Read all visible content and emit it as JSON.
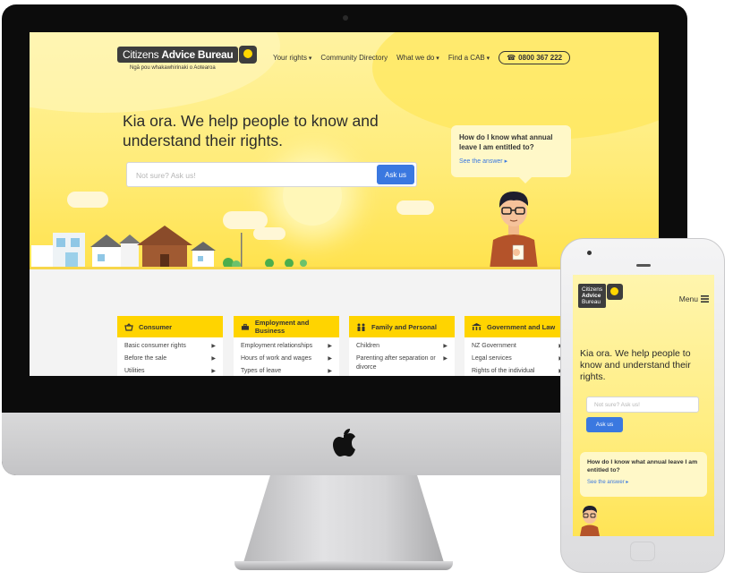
{
  "desktop": {
    "logo": {
      "name_part1": "Citizens ",
      "name_part2": "Advice Bureau",
      "tagline": "Ngā pou whakawhirinaki o Aotearoa"
    },
    "nav": [
      {
        "label": "Your rights",
        "dropdown": true
      },
      {
        "label": "Community Directory",
        "dropdown": false
      },
      {
        "label": "What we do",
        "dropdown": true
      },
      {
        "label": "Find a CAB",
        "dropdown": true
      }
    ],
    "phone_number": "0800 367 222",
    "headline": "Kia ora. We help people to know and understand their rights.",
    "search": {
      "placeholder": "Not sure? Ask us!",
      "button": "Ask us"
    },
    "faq": {
      "question": "How do I know what annual leave I am entitled to?",
      "link": "See the answer"
    },
    "categories": [
      {
        "title": "Consumer",
        "icon": "basket-icon",
        "items": [
          "Basic consumer rights",
          "Before the sale",
          "Utilities"
        ]
      },
      {
        "title": "Employment and Business",
        "icon": "briefcase-icon",
        "items": [
          "Employment relationships",
          "Hours of work and wages",
          "Types of leave"
        ]
      },
      {
        "title": "Family and Personal",
        "icon": "family-icon",
        "items": [
          "Children",
          "Parenting after separation or divorce"
        ]
      },
      {
        "title": "Government and Law",
        "icon": "government-icon",
        "items": [
          "NZ Government",
          "Legal services",
          "Rights of the individual"
        ]
      }
    ]
  },
  "mobile": {
    "logo_lines": [
      "Citizens",
      "Advice",
      "Bureau"
    ],
    "menu": "Menu",
    "headline": "Kia ora. We help people to know and understand their rights.",
    "search_placeholder": "Not sure? Ask us!",
    "ask_button": "Ask us",
    "faq": {
      "question": "How do I know what annual leave I am entitled to?",
      "link": "See the answer"
    }
  },
  "colors": {
    "brand_yellow": "#ffd400",
    "accent_blue": "#3a78e0",
    "logo_dark": "#3d3d3d"
  }
}
